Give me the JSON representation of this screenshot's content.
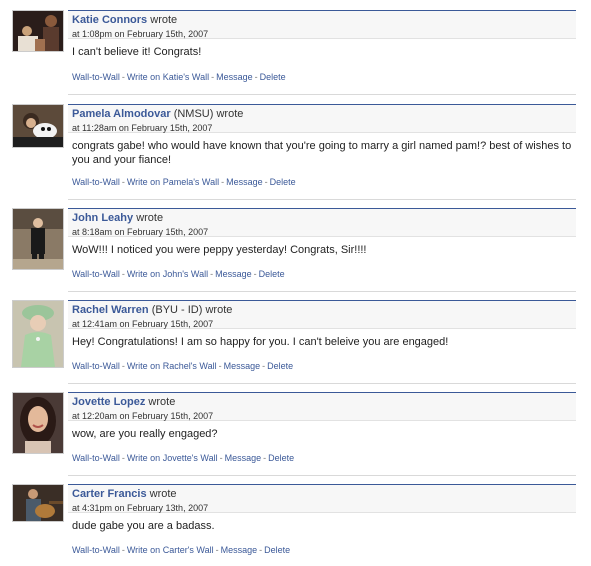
{
  "posts": [
    {
      "author": "Katie Connors",
      "network": "",
      "wrote": "wrote",
      "timestamp": "at 1:08pm on February 15th, 2007",
      "message": "I can't believe it! Congrats!",
      "actions": {
        "wall_to_wall": "Wall-to-Wall",
        "write_on_wall": "Write on Katie's Wall",
        "message": "Message",
        "delete": "Delete"
      },
      "avatar_icon": "dark-party-photo"
    },
    {
      "author": "Pamela Almodovar",
      "network": "(NMSU)",
      "wrote": "wrote",
      "timestamp": "at 11:28am on February 15th, 2007",
      "message": "congrats gabe! who would have known that you're going to marry a girl named pam!? best of wishes to you and your fiance!",
      "actions": {
        "wall_to_wall": "Wall-to-Wall",
        "write_on_wall": "Write on Pamela's Wall",
        "message": "Message",
        "delete": "Delete"
      },
      "avatar_icon": "person-with-dog-photo"
    },
    {
      "author": "John Leahy",
      "network": "",
      "wrote": "wrote",
      "timestamp": "at 8:18am on February 15th, 2007",
      "message": "WoW!!! I noticed you were peppy yesterday! Congrats, Sir!!!!",
      "actions": {
        "wall_to_wall": "Wall-to-Wall",
        "write_on_wall": "Write on John's Wall",
        "message": "Message",
        "delete": "Delete"
      },
      "avatar_icon": "man-in-suit-photo"
    },
    {
      "author": "Rachel Warren",
      "network": "(BYU - ID)",
      "wrote": "wrote",
      "timestamp": "at 12:41am on February 15th, 2007",
      "message": "Hey! Congratulations! I am so happy for you. I can't beleive you are engaged!",
      "actions": {
        "wall_to_wall": "Wall-to-Wall",
        "write_on_wall": "Write on Rachel's Wall",
        "message": "Message",
        "delete": "Delete"
      },
      "avatar_icon": "woman-green-hat-photo"
    },
    {
      "author": "Jovette Lopez",
      "network": "",
      "wrote": "wrote",
      "timestamp": "at 12:20am on February 15th, 2007",
      "message": "wow, are you really engaged?",
      "actions": {
        "wall_to_wall": "Wall-to-Wall",
        "write_on_wall": "Write on Jovette's Wall",
        "message": "Message",
        "delete": "Delete"
      },
      "avatar_icon": "woman-portrait-photo"
    },
    {
      "author": "Carter Francis",
      "network": "",
      "wrote": "wrote",
      "timestamp": "at 4:31pm on February 13th, 2007",
      "message": "dude gabe you are a badass.",
      "actions": {
        "wall_to_wall": "Wall-to-Wall",
        "write_on_wall": "Write on Carter's Wall",
        "message": "Message",
        "delete": "Delete"
      },
      "avatar_icon": "guitar-player-photo"
    }
  ]
}
